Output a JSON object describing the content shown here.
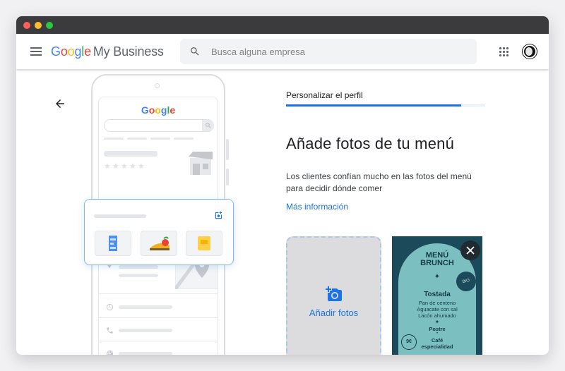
{
  "app": {
    "logo_google": [
      "G",
      "o",
      "o",
      "g",
      "l",
      "e"
    ],
    "logo_colors": [
      "#4285F4",
      "#EA4335",
      "#FBBC05",
      "#4285F4",
      "#34A853",
      "#EA4335"
    ],
    "product_name": "My Business"
  },
  "search": {
    "placeholder": "Busca alguna empresa"
  },
  "illustration": {
    "logo_text": "Google"
  },
  "progress": {
    "label": "Personalizar el perfil",
    "value": 0.88
  },
  "main": {
    "title": "Añade fotos de tu menú",
    "description": "Los clientes confían mucho en las fotos del menú para decidir dónde comer",
    "more_link": "Más información",
    "upload_label": "Añadir fotos"
  },
  "menu_photo": {
    "title_line1": "MENÚ",
    "title_line2": "BRUNCH",
    "bio_badge": "BIO",
    "dish": "Tostada",
    "ingredients": [
      "Pan de centeno",
      "Aguacate con sal",
      "Lacón ahumado"
    ],
    "dessert": "Postre",
    "coffee_line1": "Café",
    "coffee_line2": "especialidad",
    "price": "9€"
  },
  "colors": {
    "accent": "#1a73e8",
    "menu_bg": "#1b4a5a",
    "menu_arch": "#7bbfc0"
  }
}
